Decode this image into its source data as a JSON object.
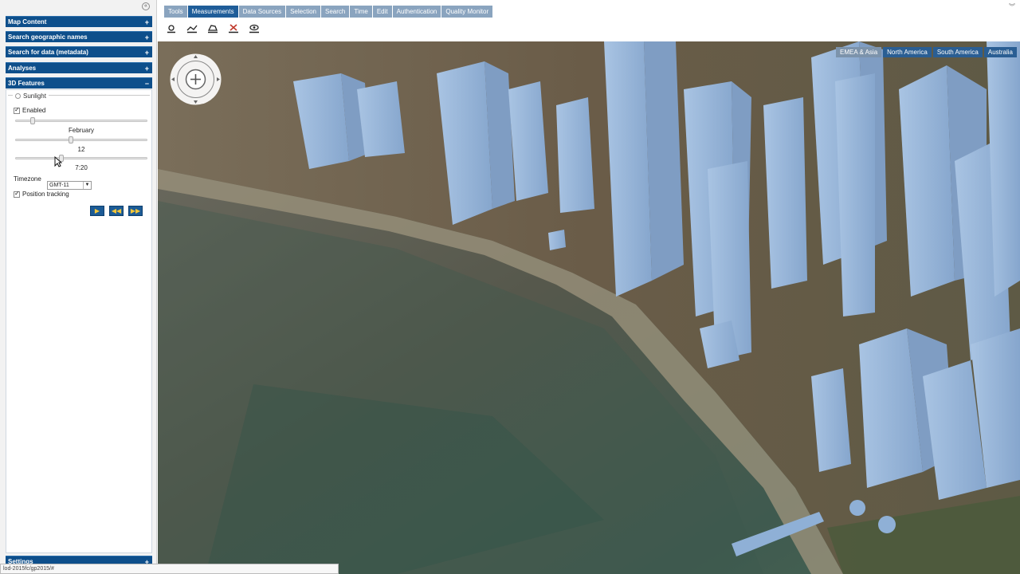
{
  "sidebar": {
    "sections": [
      {
        "label": "Map Content",
        "sign": "+"
      },
      {
        "label": "Search geographic names",
        "sign": "+"
      },
      {
        "label": "Search for data (metadata)",
        "sign": "+"
      },
      {
        "label": "Analyses",
        "sign": "+"
      },
      {
        "label": "3D Features",
        "sign": "−"
      }
    ],
    "sunlight": {
      "legend": "Sunlight",
      "enabled_label": "Enabled",
      "enabled": true,
      "month": "February",
      "day": "12",
      "time": "7:20",
      "timezone_label": "Timezone",
      "timezone_value": "GMT-11",
      "position_tracking_label": "Position tracking",
      "position_tracking": true,
      "buttons": [
        "play",
        "rewind",
        "fast-forward"
      ]
    },
    "settings": {
      "label": "Settings",
      "sign": "+"
    }
  },
  "topbar": {
    "tabs": [
      {
        "label": "Tools",
        "active": false
      },
      {
        "label": "Measurements",
        "active": true
      },
      {
        "label": "Data Sources",
        "active": false
      },
      {
        "label": "Selection",
        "active": false
      },
      {
        "label": "Search",
        "active": false
      },
      {
        "label": "Time",
        "active": false
      },
      {
        "label": "Edit",
        "active": false
      },
      {
        "label": "Authentication",
        "active": false
      },
      {
        "label": "Quality Monitor",
        "active": false
      }
    ],
    "tools": [
      "measure-point-icon",
      "measure-line-icon",
      "measure-area-icon",
      "delete-measurement-icon",
      "visibility-icon"
    ]
  },
  "map": {
    "regions": [
      {
        "label": "EMEA & Asia",
        "active": true
      },
      {
        "label": "North America",
        "active": false
      },
      {
        "label": "South America",
        "active": false
      },
      {
        "label": "Australia",
        "active": false
      }
    ]
  },
  "status": {
    "url": "lod-2015fc/gp2015/#"
  },
  "colors": {
    "header_blue": "#0e4f8b",
    "tab_active": "#1f5d99",
    "tab_inactive": "#8aa4bf",
    "building": "#8fb0d6"
  }
}
